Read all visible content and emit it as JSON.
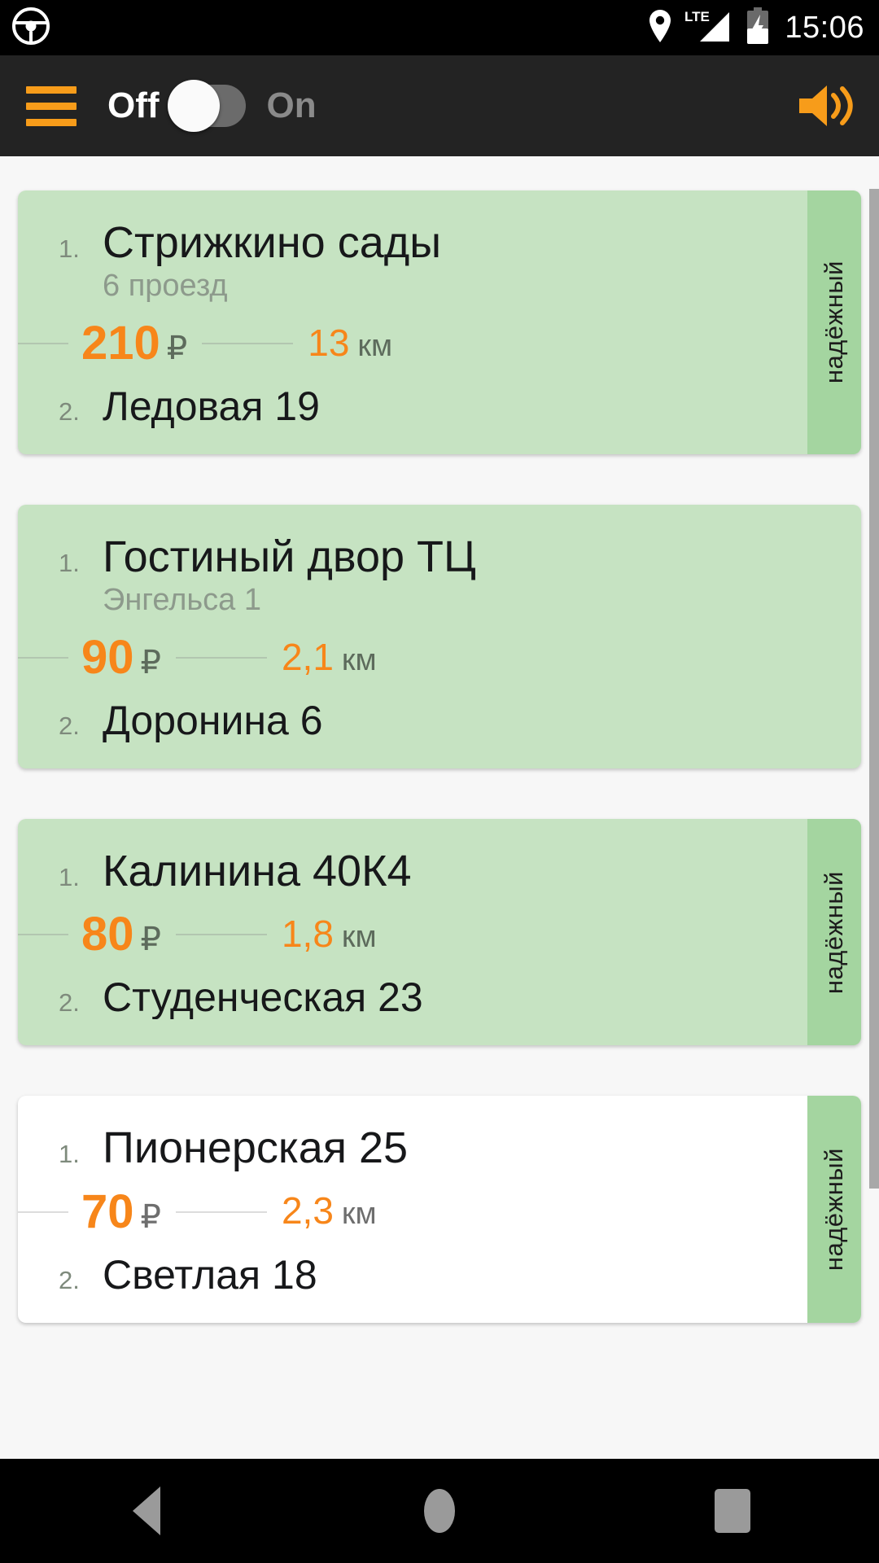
{
  "status_bar": {
    "app_icon": "steering-wheel-icon",
    "location_icon": "location-pin-icon",
    "network_label": "LTE",
    "signal_icon": "signal-bars-icon",
    "battery_icon": "battery-charging-icon",
    "time": "15:06"
  },
  "header": {
    "menu_icon": "hamburger-menu-icon",
    "off_label": "Off",
    "on_label": "On",
    "toggle_state": "off",
    "sound_icon": "speaker-on-icon",
    "accent_color": "#f79c1a",
    "background_color": "#232323"
  },
  "colors": {
    "card_green": "#c6e3c2",
    "badge_green": "#a4d5a0",
    "card_white": "#ffffff",
    "price_orange": "#f7861a",
    "page_background": "#f7f7f7"
  },
  "orders": [
    {
      "pickup_index": "1.",
      "pickup_address": "Стрижкино сады",
      "pickup_detail": "6 проезд",
      "price": "210",
      "currency": "₽",
      "distance": "13",
      "distance_unit": "км",
      "dropoff_index": "2.",
      "dropoff_address": "Ледовая 19",
      "badge_label": "надёжный",
      "has_badge": true,
      "card_style": "green"
    },
    {
      "pickup_index": "1.",
      "pickup_address": "Гостиный двор ТЦ",
      "pickup_detail": "Энгельса 1",
      "price": "90",
      "currency": "₽",
      "distance": "2,1",
      "distance_unit": "км",
      "dropoff_index": "2.",
      "dropoff_address": "Доронина 6",
      "badge_label": "",
      "has_badge": false,
      "card_style": "green"
    },
    {
      "pickup_index": "1.",
      "pickup_address": "Калинина 40К4",
      "pickup_detail": "",
      "price": "80",
      "currency": "₽",
      "distance": "1,8",
      "distance_unit": "км",
      "dropoff_index": "2.",
      "dropoff_address": "Студенческая 23",
      "badge_label": "надёжный",
      "has_badge": true,
      "card_style": "green"
    },
    {
      "pickup_index": "1.",
      "pickup_address": "Пионерская 25",
      "pickup_detail": "",
      "price": "70",
      "currency": "₽",
      "distance": "2,3",
      "distance_unit": "км",
      "dropoff_index": "2.",
      "dropoff_address": "Светлая 18",
      "badge_label": "надёжный",
      "has_badge": true,
      "card_style": "white"
    }
  ],
  "nav_bar": {
    "back_icon": "back-triangle-icon",
    "home_icon": "home-circle-icon",
    "recents_icon": "recents-square-icon"
  }
}
